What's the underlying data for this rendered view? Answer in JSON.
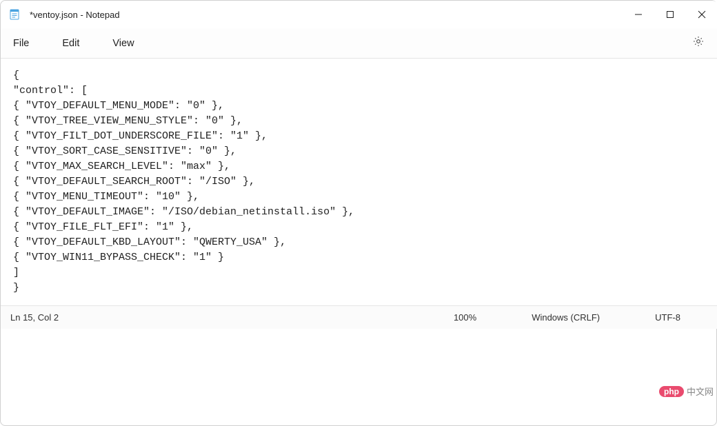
{
  "titlebar": {
    "title": "*ventoy.json - Notepad"
  },
  "menubar": {
    "file": "File",
    "edit": "Edit",
    "view": "View"
  },
  "editor": {
    "content": "{\n\"control\": [\n{ \"VTOY_DEFAULT_MENU_MODE\": \"0\" },\n{ \"VTOY_TREE_VIEW_MENU_STYLE\": \"0\" },\n{ \"VTOY_FILT_DOT_UNDERSCORE_FILE\": \"1\" },\n{ \"VTOY_SORT_CASE_SENSITIVE\": \"0\" },\n{ \"VTOY_MAX_SEARCH_LEVEL\": \"max\" },\n{ \"VTOY_DEFAULT_SEARCH_ROOT\": \"/ISO\" },\n{ \"VTOY_MENU_TIMEOUT\": \"10\" },\n{ \"VTOY_DEFAULT_IMAGE\": \"/ISO/debian_netinstall.iso\" },\n{ \"VTOY_FILE_FLT_EFI\": \"1\" },\n{ \"VTOY_DEFAULT_KBD_LAYOUT\": \"QWERTY_USA\" },\n{ \"VTOY_WIN11_BYPASS_CHECK\": \"1\" }\n]\n}"
  },
  "statusbar": {
    "position": "Ln 15, Col 2",
    "zoom": "100%",
    "line_ending": "Windows (CRLF)",
    "encoding": "UTF-8"
  },
  "watermark": {
    "pill": "php",
    "text": "中文网"
  }
}
